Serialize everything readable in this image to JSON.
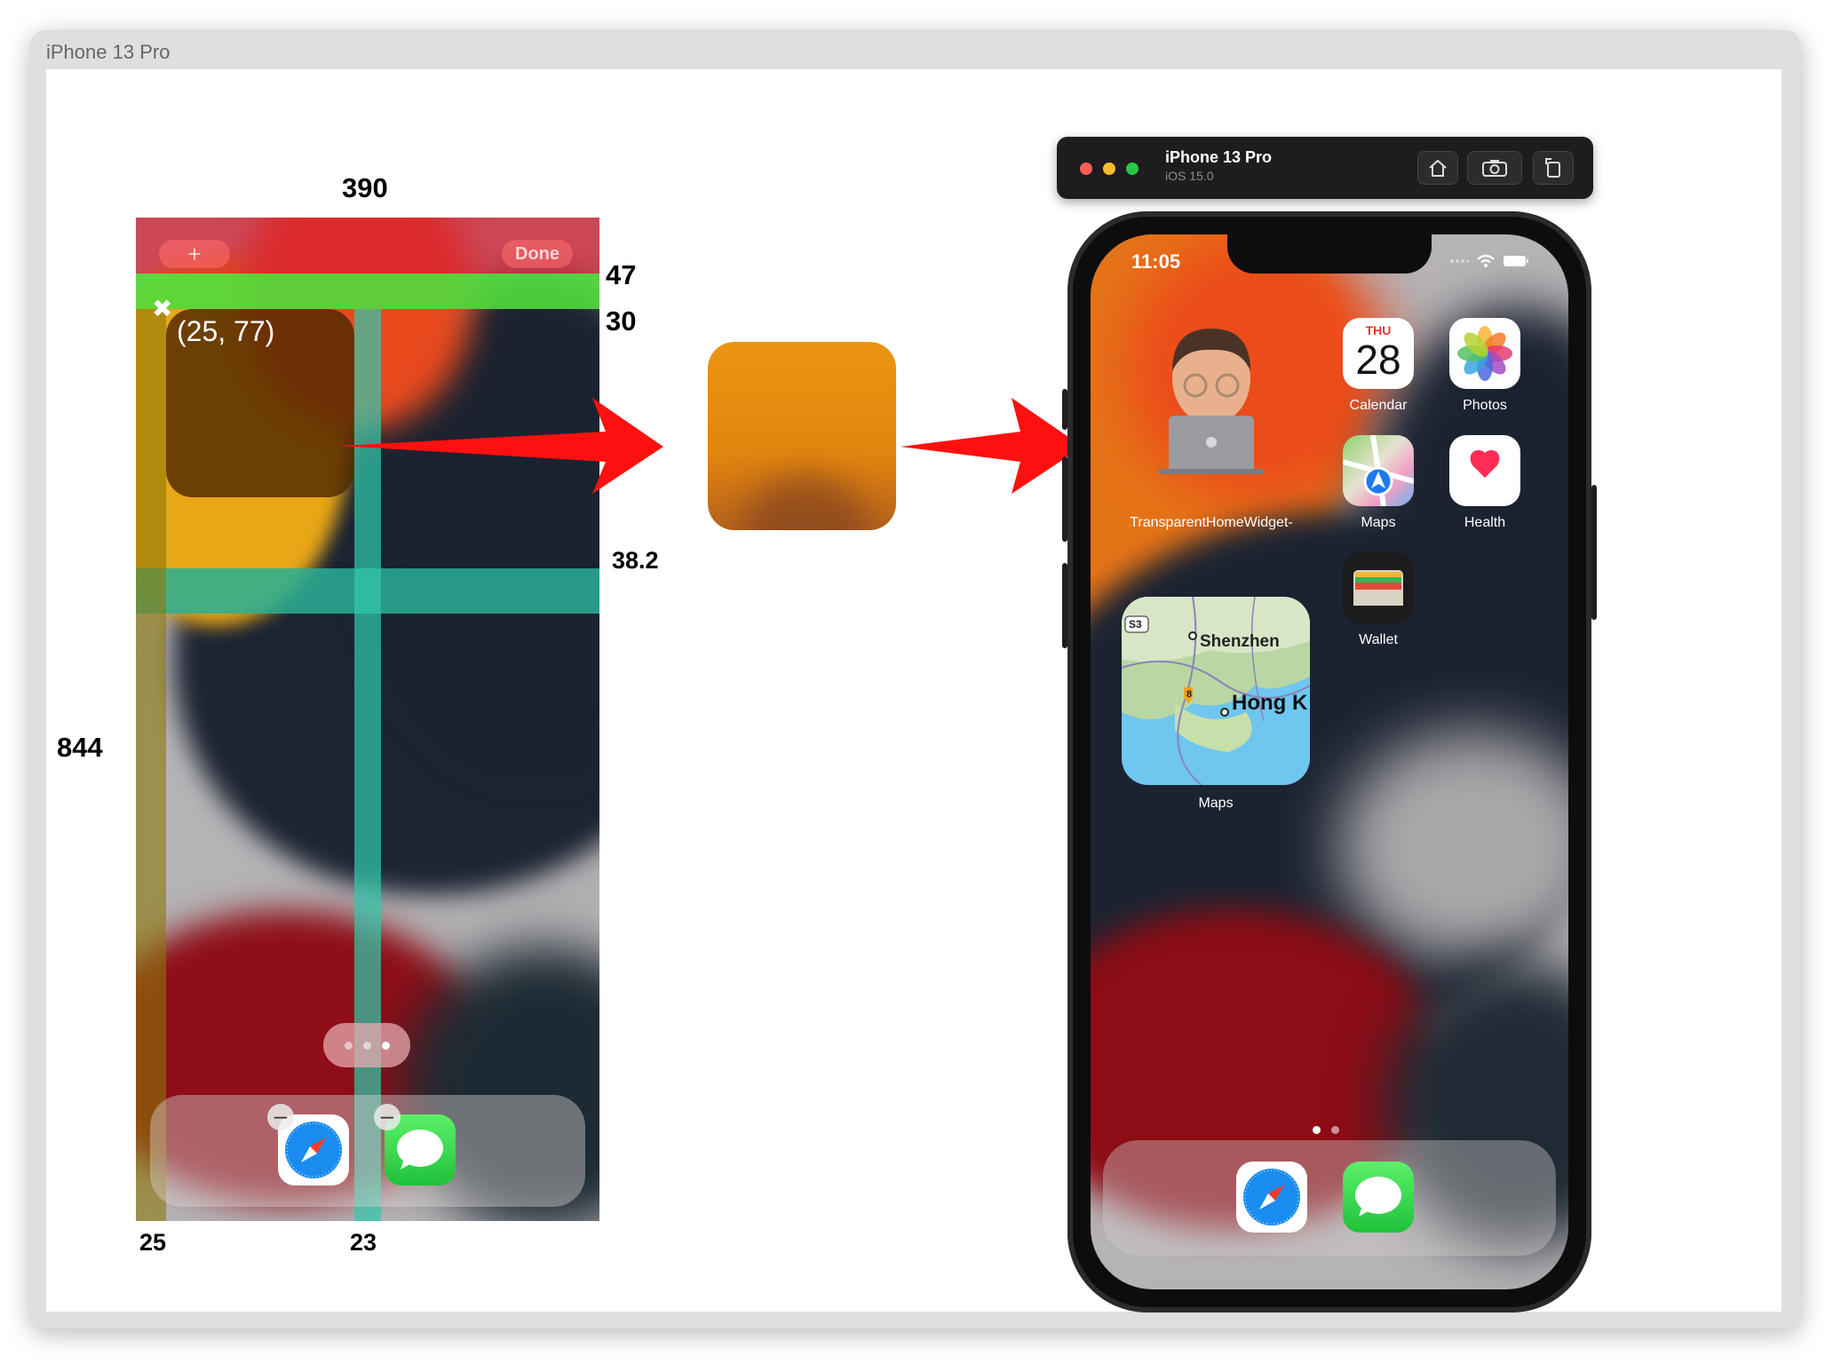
{
  "window": {
    "title": "iPhone 13 Pro"
  },
  "diagram": {
    "add_label": "+",
    "done_label": "Done",
    "close_mark": "✖",
    "coord_label": "(25, 77)",
    "dims": {
      "width": "390",
      "top_bar": "47",
      "green_band": "30",
      "teal_band": "38.2",
      "height": "844",
      "left_margin": "25",
      "gap": "23"
    },
    "minus_symbol": "–"
  },
  "simulator": {
    "title": "iPhone 13 Pro",
    "subtitle": "iOS 15.0",
    "buttons": [
      "home-icon",
      "camera-icon",
      "rotate-icon"
    ],
    "traffic_colors": [
      "#fe5f57",
      "#febc2e",
      "#28c840"
    ]
  },
  "phone": {
    "time": "11:05",
    "apps": [
      {
        "label": "Calendar",
        "day": "THU",
        "date": "28"
      },
      {
        "label": "Photos"
      },
      {
        "label": "Maps"
      },
      {
        "label": "Health"
      },
      {
        "label": "Wallet"
      }
    ],
    "widget_label": "TransparentHomeWidget-",
    "map_widget": {
      "label": "Maps",
      "city1": "Shenzhen",
      "city2": "Hong K",
      "route1": "S3",
      "route2": "8"
    },
    "dock_apps": [
      "Safari",
      "Messages"
    ]
  },
  "colors": {
    "accent_red": "#ff1a1a",
    "band_green": "#50dc3c",
    "band_teal": "#28af96"
  }
}
